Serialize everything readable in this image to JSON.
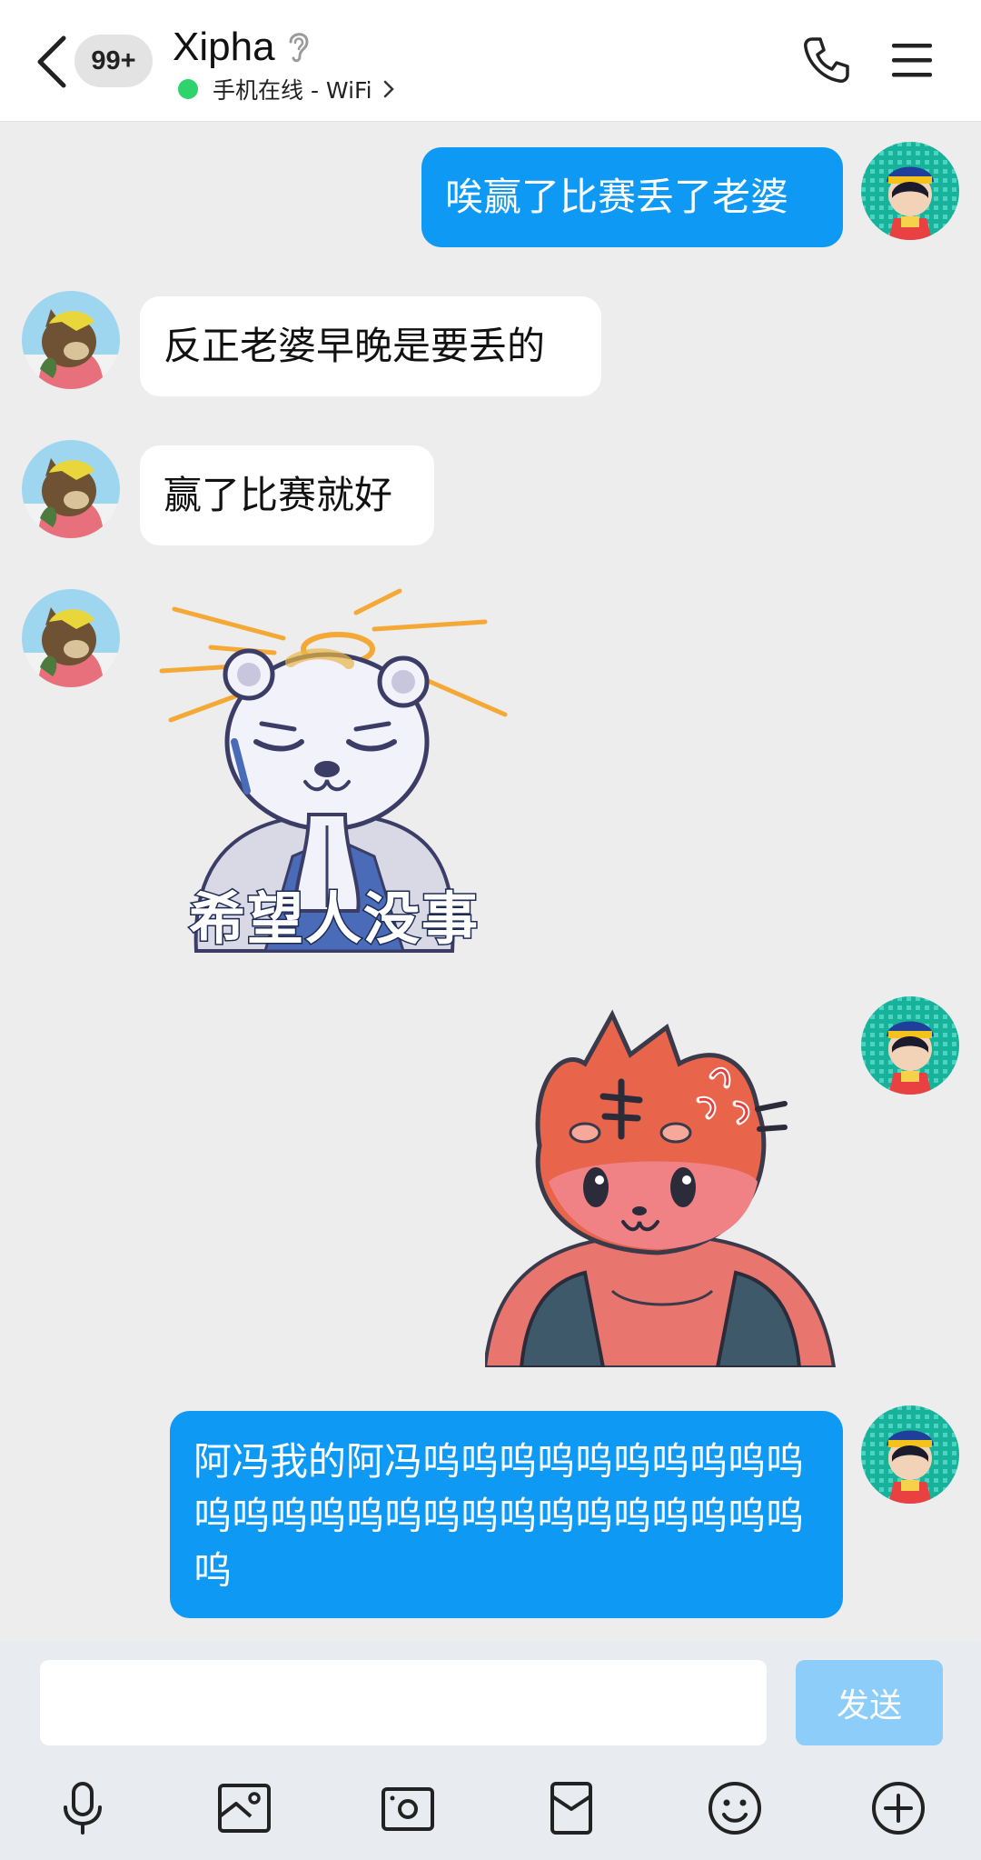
{
  "header": {
    "unread_badge": "99+",
    "contact_name": "Xipha",
    "status_text": "手机在线 - WiFi",
    "online_color": "#2fd36b"
  },
  "icons": {
    "back": "chevron-left-icon",
    "hearing": "ear-icon",
    "status_more": "chevron-right-icon",
    "call": "phone-icon",
    "menu": "hamburger-menu-icon",
    "voice": "microphone-icon",
    "image": "image-icon",
    "camera": "camera-icon",
    "red_packet": "red-packet-icon",
    "emoji": "smiley-icon",
    "more": "plus-circle-icon"
  },
  "messages": [
    {
      "side": "out",
      "type": "text",
      "text": "唉赢了比赛丢了老婆"
    },
    {
      "side": "in",
      "type": "text",
      "text": "反正老婆早晚是要丢的"
    },
    {
      "side": "in",
      "type": "text",
      "text": "赢了比赛就好"
    },
    {
      "side": "in",
      "type": "sticker",
      "caption": "希望人没事"
    },
    {
      "side": "out",
      "type": "sticker",
      "caption": ""
    },
    {
      "side": "out",
      "type": "text",
      "text": "阿冯我的阿冯呜呜呜呜呜呜呜呜呜呜呜呜呜呜呜呜呜呜呜呜呜呜呜呜呜呜呜"
    }
  ],
  "composer": {
    "input_value": "",
    "input_placeholder": "",
    "send_label": "发送"
  },
  "colors": {
    "outgoing_bubble": "#0e99f5",
    "incoming_bubble": "#ffffff",
    "chat_background": "#ededed",
    "send_button_disabled": "#8dcdfa"
  }
}
